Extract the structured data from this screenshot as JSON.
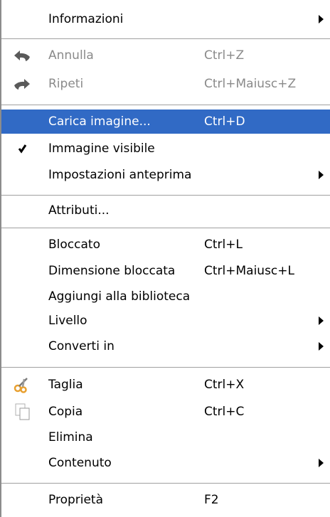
{
  "menu": {
    "items": [
      {
        "label": "Informazioni",
        "shortcut": "",
        "submenu": true
      },
      {
        "label": "Annulla",
        "shortcut": "Ctrl+Z",
        "disabled": true,
        "icon": "undo-arrow-icon"
      },
      {
        "label": "Ripeti",
        "shortcut": "Ctrl+Maiusc+Z",
        "disabled": true,
        "icon": "redo-arrow-icon"
      },
      {
        "label": "Carica imagine...",
        "shortcut": "Ctrl+D",
        "selected": true
      },
      {
        "label": "Immagine visibile",
        "shortcut": "",
        "checked": true
      },
      {
        "label": "Impostazioni anteprima",
        "shortcut": "",
        "submenu": true
      },
      {
        "label": "Attributi...",
        "shortcut": ""
      },
      {
        "label": "Bloccato",
        "shortcut": "Ctrl+L"
      },
      {
        "label": "Dimensione bloccata",
        "shortcut": "Ctrl+Maiusc+L"
      },
      {
        "label": "Aggiungi alla biblioteca",
        "shortcut": ""
      },
      {
        "label": "Livello",
        "shortcut": "",
        "submenu": true
      },
      {
        "label": "Converti in",
        "shortcut": "",
        "submenu": true
      },
      {
        "label": "Taglia",
        "shortcut": "Ctrl+X",
        "icon": "scissors-icon"
      },
      {
        "label": "Copia",
        "shortcut": "Ctrl+C",
        "icon": "copy-icon"
      },
      {
        "label": "Elimina",
        "shortcut": ""
      },
      {
        "label": "Contenuto",
        "shortcut": "",
        "submenu": true
      },
      {
        "label": "Proprietà",
        "shortcut": "F2"
      }
    ]
  },
  "colors": {
    "highlight": "#316ac5",
    "highlight_text": "#ffffff",
    "disabled_text": "#8a8a8a",
    "menu_background": "#ffffff"
  }
}
